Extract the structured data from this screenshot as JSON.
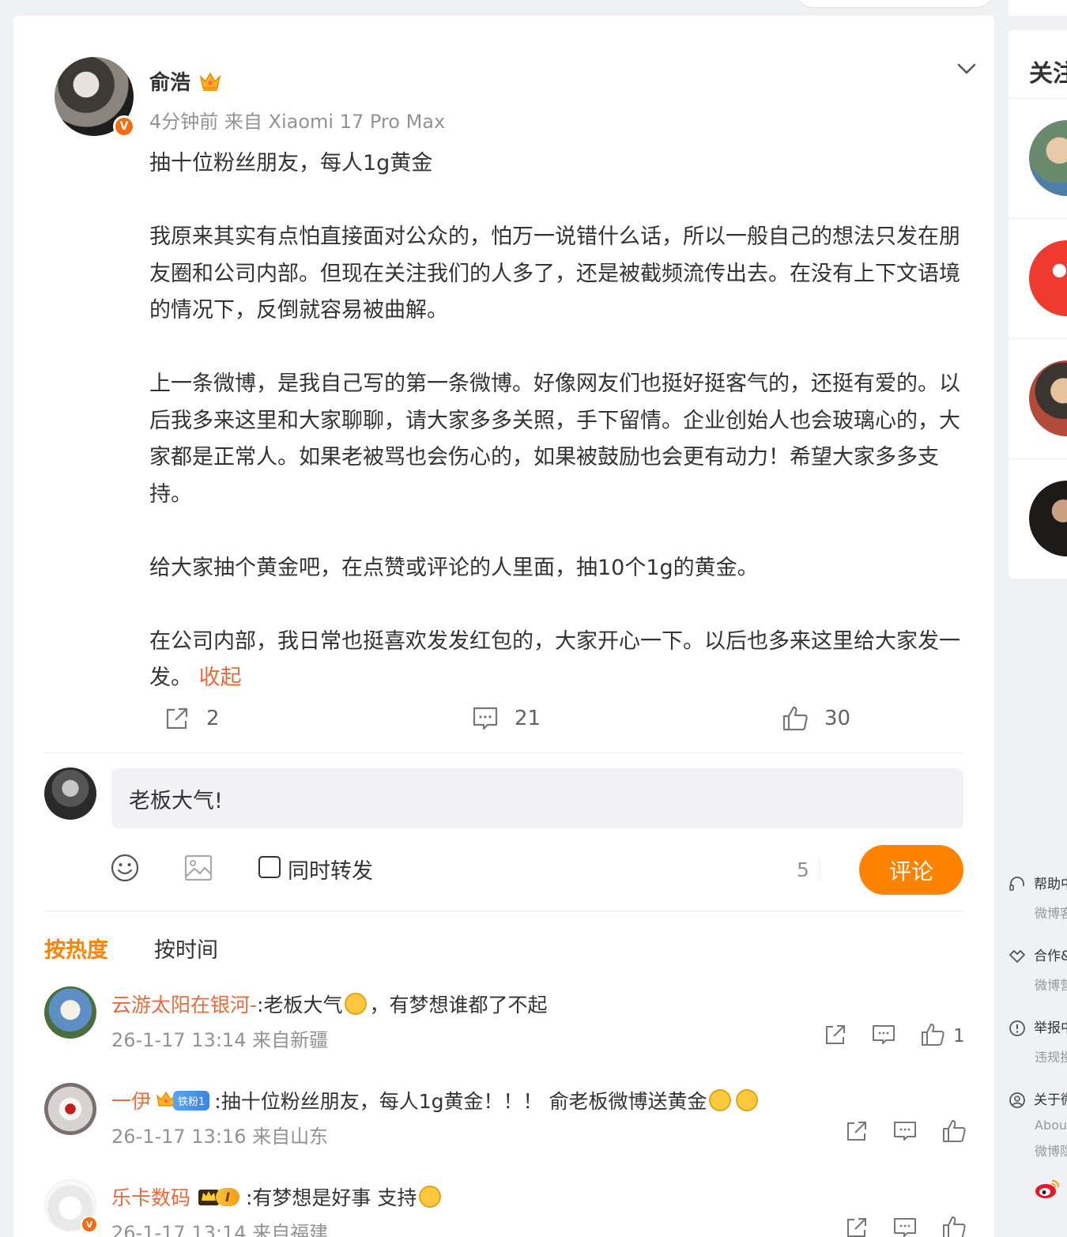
{
  "post": {
    "author": "俞浩",
    "meta": "4分钟前 来自 Xiaomi 17 Pro Max",
    "paragraphs": [
      "抽十位粉丝朋友，每人1g黄金",
      "我原来其实有点怕直接面对公众的，怕万一说错什么话，所以一般自己的想法只发在朋友圈和公司内部。但现在关注我们的人多了，还是被截频流传出去。在没有上下文语境的情况下，反倒就容易被曲解。",
      "上一条微博，是我自己写的第一条微博。好像网友们也挺好挺客气的，还挺有爱的。以后我多来这里和大家聊聊，请大家多多关照，手下留情。企业创始人也会玻璃心的，大家都是正常人。如果老被骂也会伤心的，如果被鼓励也会更有动力！希望大家多多支持。",
      "给大家抽个黄金吧，在点赞或评论的人里面，抽10个1g的黄金。",
      "在公司内部，我日常也挺喜欢发发红包的，大家开心一下。以后也多来这里给大家发一发。"
    ],
    "collapse_label": "收起",
    "reposts": "2",
    "comments": "21",
    "likes": "30",
    "verified_mark": "V"
  },
  "composer": {
    "value": "老板大气!",
    "repost_label": "同时转发",
    "char_count": "5",
    "submit_label": "评论"
  },
  "sort": {
    "hot_label": "按热度",
    "time_label": "按时间"
  },
  "comments": [
    {
      "user": "云游太阳在银河-",
      "text_before": ":老板大气",
      "text_after": "，有梦想谁都了不起",
      "time": "26-1-17 13:14 来自新疆",
      "likes": "1"
    },
    {
      "user": "一伊",
      "fan_badge": "铁粉1",
      "text": " :抽十位粉丝朋友，每人1g黄金！！！ 俞老板微博送黄金",
      "time": "26-1-17 13:16 来自山东",
      "likes": ""
    },
    {
      "user": "乐卡数码",
      "level_badge": "I",
      "text": " :有梦想是好事 支持",
      "time": "26-1-17 13:14 来自福建",
      "likes": "",
      "verified_mark": "V"
    }
  ],
  "right_panel": {
    "title": "关注"
  },
  "footer": [
    {
      "label": "帮助中心",
      "sub": "微博客服",
      "icon": "headset-icon"
    },
    {
      "label": "合作&服务",
      "sub": "微博营销",
      "icon": "handshake-icon"
    },
    {
      "label": "举报中心",
      "sub": "违规投诉",
      "icon": "alert-icon"
    },
    {
      "label": "关于微博",
      "sub": "About",
      "sub2": "微博隐私",
      "icon": "user-circle-icon"
    }
  ],
  "colors": {
    "brand_orange": "#ff8200",
    "username": "#ea6a3c",
    "muted": "#939393"
  }
}
